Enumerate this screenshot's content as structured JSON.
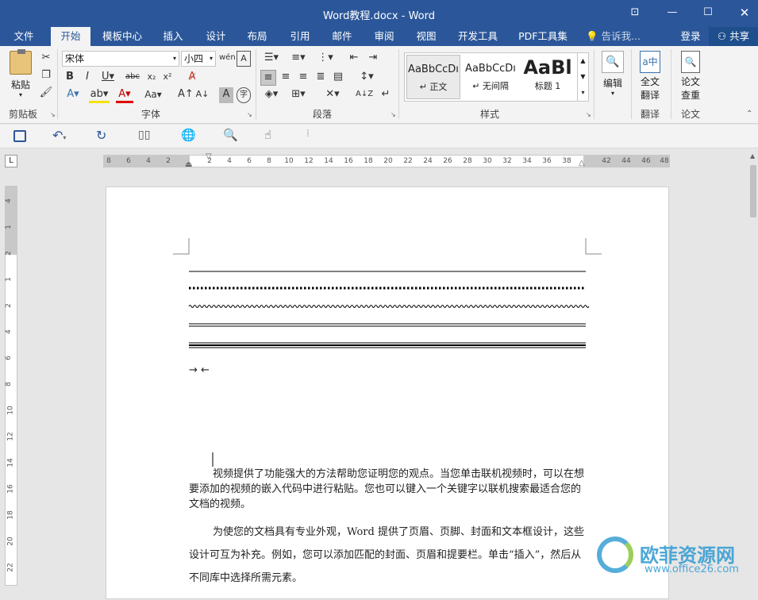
{
  "window": {
    "title": "Word教程.docx - Word"
  },
  "tabs": [
    "文件",
    "开始",
    "模板中心",
    "插入",
    "设计",
    "布局",
    "引用",
    "邮件",
    "审阅",
    "视图",
    "开发工具",
    "PDF工具集"
  ],
  "tell_me": "告诉我...",
  "sign_in": "登录",
  "share": "共享",
  "clipboard": {
    "paste_label": "粘贴",
    "group_label": "剪贴板"
  },
  "font": {
    "name": "宋体",
    "size": "小四",
    "group_label": "字体"
  },
  "paragraph": {
    "group_label": "段落"
  },
  "styles": {
    "items": [
      {
        "preview": "AaBbCcDı",
        "name": "↵ 正文"
      },
      {
        "preview": "AaBbCcDı",
        "name": "↵ 无间隔"
      },
      {
        "preview": "AaBl",
        "name": "标题 1"
      }
    ],
    "group_label": "样式"
  },
  "editing": {
    "label": "编辑"
  },
  "translate": {
    "label1": "全文",
    "label2": "翻译",
    "group_label": "翻译"
  },
  "thesis": {
    "label1": "论文",
    "label2": "查重",
    "group_label": "论文"
  },
  "ruler": {
    "left_nums": [
      "8",
      "6",
      "4",
      "2"
    ],
    "nums": [
      "2",
      "4",
      "6",
      "8",
      "10",
      "12",
      "14",
      "16",
      "18",
      "20",
      "22",
      "24",
      "26",
      "28",
      "30",
      "32",
      "34",
      "36",
      "38"
    ],
    "right_nums": [
      "42",
      "44",
      "46",
      "48"
    ]
  },
  "vruler": {
    "nums": [
      "4",
      "1",
      "2",
      "1",
      "2",
      "4",
      "6",
      "8",
      "10",
      "12",
      "14",
      "16",
      "18",
      "20",
      "22"
    ]
  },
  "doc": {
    "arrows": "→ ←",
    "p1": "视频提供了功能强大的方法帮助您证明您的观点。当您单击联机视频时，可以在想要添加的视频的嵌入代码中进行粘贴。您也可以键入一个关键字以联机搜索最适合您的文档的视频。",
    "p2": "为使您的文档具有专业外观，Word 提供了页眉、页脚、封面和文本框设计，这些设计可互为补充。例如，您可以添加匹配的封面、页眉和提要栏。单击“插入”，然后从不同库中选择所需元素。"
  },
  "watermark": {
    "name": "欧菲资源网",
    "url": "www.office26.com"
  }
}
